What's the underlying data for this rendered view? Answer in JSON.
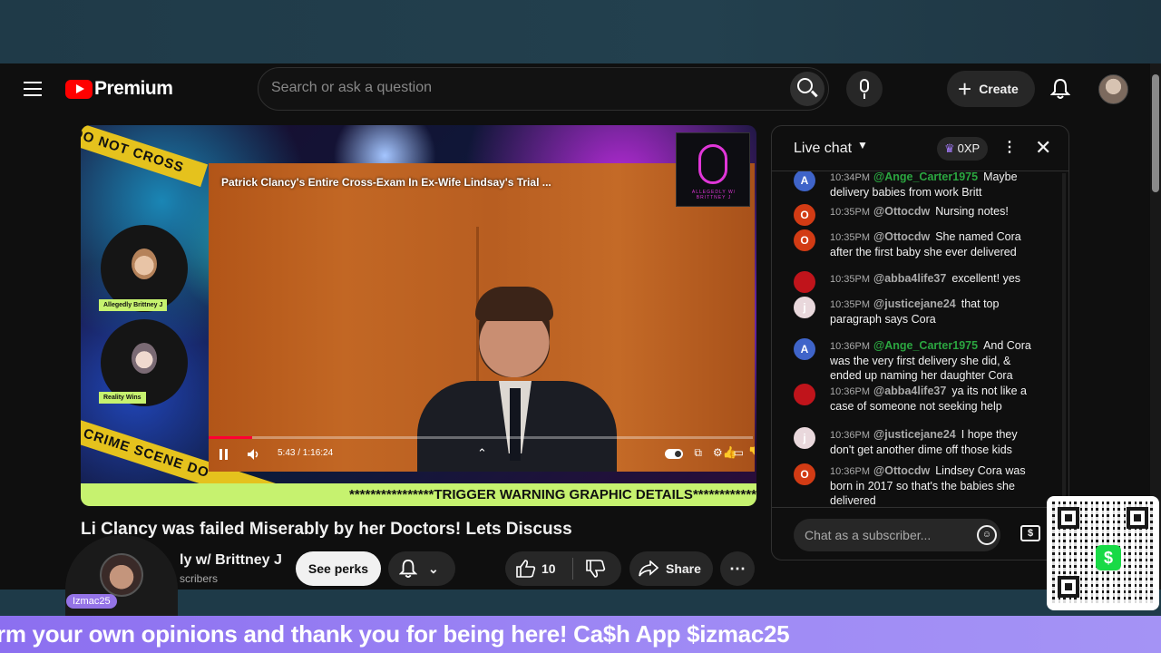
{
  "header": {
    "logo_text": "Premium",
    "search_placeholder": "Search or ask a question",
    "create_label": "Create"
  },
  "video": {
    "inner_title": "Patrick Clancy's Entire Cross-Exam In Ex-Wife Lindsay's Trial ...",
    "time": "5:43 / 1:16:24",
    "progress_fraction": 0.08,
    "warning": "****************TRIGGER WARNING GRAPHIC DETAILS************",
    "tape_top": "DO NOT CROSS",
    "tape_bottom": "CRIME SCENE DO",
    "cam_tag_1": "Allegedly Brittney J",
    "cam_tag_2": "Reality Wins",
    "mic_card_label": "ALLEGEDLY W/ BRITTNEY J"
  },
  "meta": {
    "title": "Li     Clancy was failed Miserably by her Doctors! Lets Discuss",
    "channel": "ly w/ Brittney J",
    "subscribers": "scribers",
    "see_perks": "See perks",
    "likes": "10",
    "share": "Share"
  },
  "chat": {
    "title": "Live chat",
    "xp": "0XP",
    "input_placeholder": "Chat as a subscriber...",
    "messages": [
      {
        "avatar": "A",
        "color": "#3f64c9",
        "time": "10:34PM",
        "author": "@Ange_Carter1975",
        "mod": true,
        "text": "Maybe delivery babies from work Britt"
      },
      {
        "avatar": "O",
        "color": "#d23b14",
        "time": "10:35PM",
        "author": "@Ottocdw",
        "mod": false,
        "text": "Nursing notes!"
      },
      {
        "avatar": "O",
        "color": "#d23b14",
        "time": "10:35PM",
        "author": "@Ottocdw",
        "mod": false,
        "text": "She named Cora after the first baby she ever delivered"
      },
      {
        "avatar": "abba",
        "color": "#c0141b",
        "time": "10:35PM",
        "author": "@abba4life37",
        "mod": false,
        "text": "excellent! yes"
      },
      {
        "avatar": "j",
        "color": "#e9d8dc",
        "time": "10:35PM",
        "author": "@justicejane24",
        "mod": false,
        "text": "that top paragraph says Cora"
      },
      {
        "avatar": "A",
        "color": "#3f64c9",
        "time": "10:36PM",
        "author": "@Ange_Carter1975",
        "mod": true,
        "text": "And Cora was the very first delivery she did, & ended up naming her daughter Cora"
      },
      {
        "avatar": "abba",
        "color": "#c0141b",
        "time": "10:36PM",
        "author": "@abba4life37",
        "mod": false,
        "text": "ya its not like a case of someone not seeking help"
      },
      {
        "avatar": "j",
        "color": "#e9d8dc",
        "time": "10:36PM",
        "author": "@justicejane24",
        "mod": false,
        "text": "I hope they don't get another dime off those kids"
      },
      {
        "avatar": "O",
        "color": "#d23b14",
        "time": "10:36PM",
        "author": "@Ottocdw",
        "mod": false,
        "text": "Lindsey Cora was born in 2017 so that's the babies she delivered"
      }
    ]
  },
  "overlay": {
    "streamer_tag": "Izmac25",
    "ticker": "rm your own opinions and thank you for being here! Ca$h App $izmac25"
  }
}
